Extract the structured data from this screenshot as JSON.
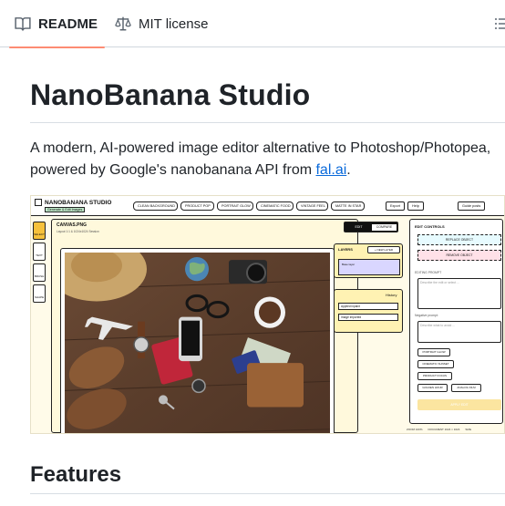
{
  "tabs": {
    "readme": "README",
    "license": "MIT license"
  },
  "article": {
    "title": "NanoBanana Studio",
    "intro_text": "A modern, AI-powered image editor alternative to Photoshop/Photopea, powered by Google's nanobanana API from ",
    "intro_link": "fal.ai",
    "intro_end": ".",
    "features_heading": "Features"
  },
  "screenshot": {
    "app_title": "NANOBANANA STUDIO",
    "app_subtitle": "Generate & Edit Images",
    "quick_actions": [
      "CLEAN BACKGROUND",
      "PRODUCT POP",
      "PORTRAIT GLOW",
      "CINEMATIC FOOD",
      "VINTAGE FEEL",
      "MATTE IN STAR"
    ],
    "top_buttons": [
      "Export",
      "Help",
      "Guide posts"
    ],
    "sidebar": [
      "SELECT",
      "TEXT",
      "BRUSH",
      "SHAPE"
    ],
    "canvas_label": "CANVAS.PNG",
    "canvas_sub": "Layout 1:1 & 1024x1024 Session",
    "toggle_edit": "EDIT",
    "toggle_compare": "COMPARE",
    "layers_title": "LAYERS",
    "layers_button": "+ NEW LAYER",
    "layer_name": "Base layer",
    "history_title": "History",
    "history_items": [
      "Applied inpaint",
      "Image imported"
    ],
    "edit_title": "EDIT CONTROLS",
    "replace_label": "REPLACE OBJECT",
    "remove_label": "REMOVE OBJECT",
    "prompt_label": "EDITING PROMPT",
    "prompt_placeholder": "Describe the edit or select ...",
    "negative_label": "Negative prompt:",
    "negative_placeholder": "Describe what to avoid ...",
    "presets": [
      "PORTRAIT GLOW",
      "CINEMATIC SUNSET",
      "PRODUCT FOCUS",
      "GOLDEN HOUR",
      "ANALOG FILM"
    ],
    "apply_label": "APPLY EDIT",
    "status": [
      "ZOOM 100%",
      "DOCUMENT 1024 × 1024",
      "SIZE"
    ]
  }
}
